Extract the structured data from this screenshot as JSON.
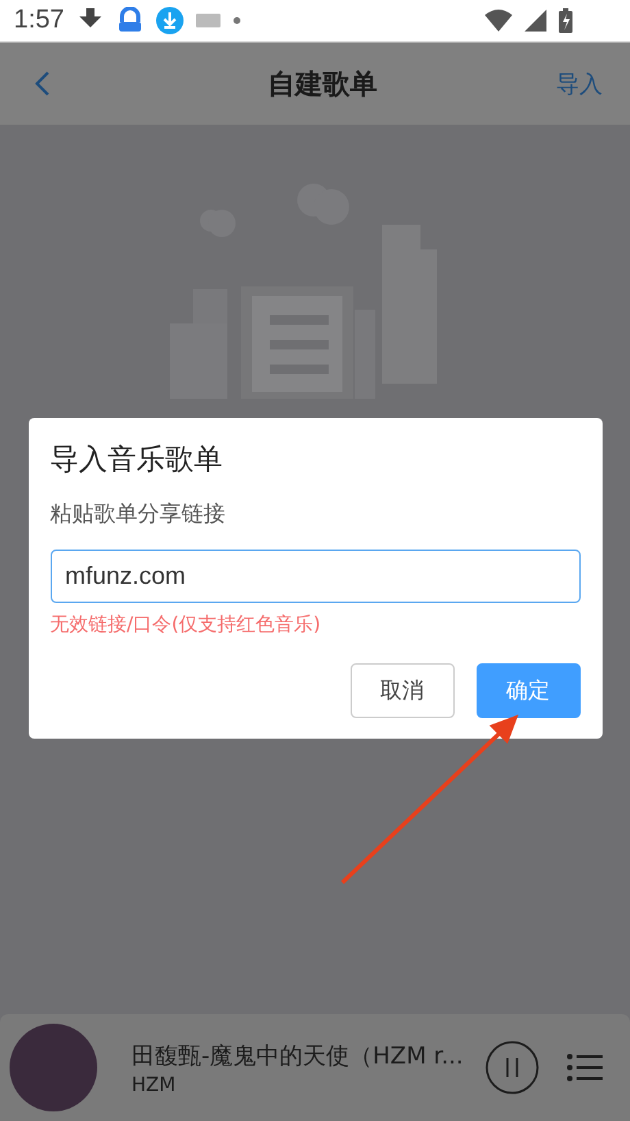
{
  "status_bar": {
    "time": "1:57"
  },
  "header": {
    "title": "自建歌单",
    "action": "导入"
  },
  "dialog": {
    "title": "导入音乐歌单",
    "subtitle": "粘贴歌单分享链接",
    "input": {
      "value": "mfunz.com"
    },
    "error": "无效链接/口令(仅支持红色音乐)",
    "buttons": [
      {
        "label": "取消",
        "kind": "secondary"
      },
      {
        "label": "确定",
        "kind": "primary"
      }
    ]
  },
  "player": {
    "title": "田馥甄-魔鬼中的天使（HZM r...",
    "artist": "HZM",
    "playing": true
  }
}
